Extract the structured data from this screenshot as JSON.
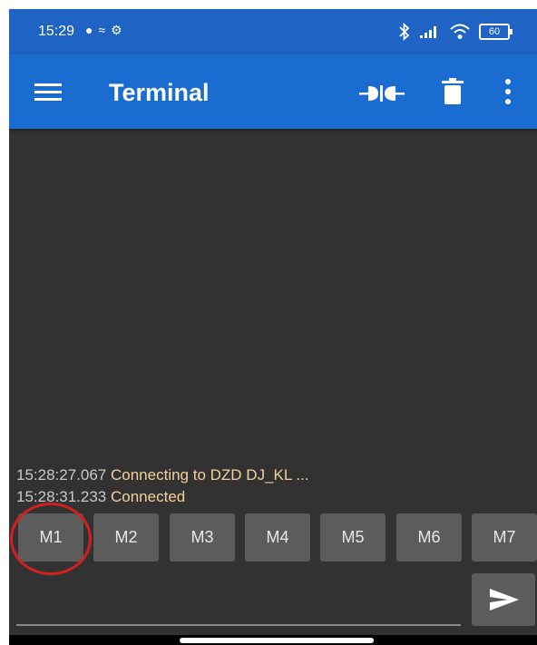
{
  "status_bar": {
    "time": "15:29",
    "battery": "60",
    "icons": [
      "chat-bubble-icon",
      "nfc-icon",
      "gear-icon",
      "bluetooth-icon",
      "signal-icon",
      "wifi-icon",
      "battery-icon"
    ]
  },
  "app_bar": {
    "title": "Terminal",
    "icons": [
      "menu-icon",
      "connect-plug-icon",
      "delete-icon",
      "more-vert-icon"
    ]
  },
  "terminal": {
    "lines": [
      {
        "time": "15:28:27.067",
        "message": "Connecting to DZD DJ_KL ..."
      },
      {
        "time": "15:28:31.233",
        "message": "Connected"
      }
    ]
  },
  "macros": [
    "M1",
    "M2",
    "M3",
    "M4",
    "M5",
    "M6",
    "M7"
  ],
  "input": {
    "value": "",
    "send_icon": "send-icon"
  },
  "colors": {
    "status_bar": "#1f63c4",
    "app_bar": "#1a6cd0",
    "background": "#323232",
    "button": "#5c5c5c",
    "message_text": "#f3d19b",
    "highlight": "#d42020"
  }
}
